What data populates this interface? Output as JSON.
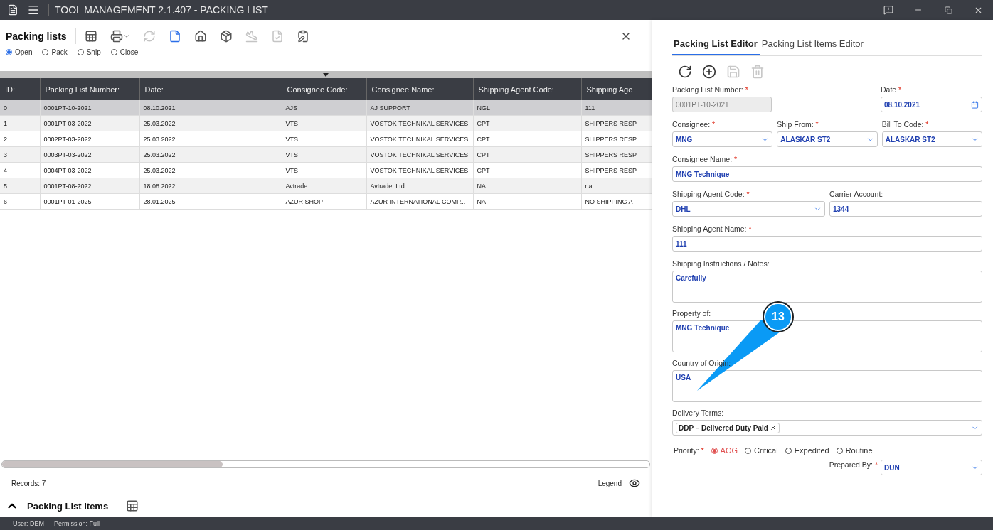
{
  "window": {
    "title": "TOOL MANAGEMENT 2.1.407 - PACKING LIST"
  },
  "list_panel": {
    "title": "Packing lists",
    "toolbar": [
      {
        "kind": "excel",
        "disabled": false
      },
      {
        "kind": "print",
        "disabled": false
      },
      {
        "kind": "refresh",
        "disabled": true
      },
      {
        "kind": "document",
        "disabled": false
      },
      {
        "kind": "home",
        "disabled": false
      },
      {
        "kind": "box",
        "disabled": false
      },
      {
        "kind": "plane",
        "disabled": true
      },
      {
        "kind": "doc-check",
        "disabled": true
      },
      {
        "kind": "clipboard",
        "disabled": false
      }
    ],
    "filters": [
      {
        "label": "Open",
        "selected": true
      },
      {
        "label": "Pack",
        "selected": false
      },
      {
        "label": "Ship",
        "selected": false
      },
      {
        "label": "Close",
        "selected": false
      }
    ],
    "table": {
      "columns": [
        "ID:",
        "Packing List Number:",
        "Date:",
        "Consignee Code:",
        "Consignee Name:",
        "Shipping Agent Code:",
        "Shipping Age"
      ],
      "rows": [
        {
          "selected": true,
          "cells": [
            "0",
            "0001PT-10-2021",
            "08.10.2021",
            "AJS",
            "AJ SUPPORT",
            "NGL",
            "111"
          ]
        },
        {
          "selected": false,
          "cells": [
            "1",
            "0001PT-03-2022",
            "25.03.2022",
            "VTS",
            "VOSTOK TECHNIKAL SERVICES",
            "CPT",
            "SHIPPERS RESP"
          ]
        },
        {
          "selected": false,
          "cells": [
            "2",
            "0002PT-03-2022",
            "25.03.2022",
            "VTS",
            "VOSTOK TECHNIKAL SERVICES",
            "CPT",
            "SHIPPERS RESP"
          ]
        },
        {
          "selected": false,
          "cells": [
            "3",
            "0003PT-03-2022",
            "25.03.2022",
            "VTS",
            "VOSTOK TECHNIKAL SERVICES",
            "CPT",
            "SHIPPERS RESP"
          ]
        },
        {
          "selected": false,
          "cells": [
            "4",
            "0004PT-03-2022",
            "25.03.2022",
            "VTS",
            "VOSTOK TECHNIKAL SERVICES",
            "CPT",
            "SHIPPERS RESP"
          ]
        },
        {
          "selected": false,
          "cells": [
            "5",
            "0001PT-08-2022",
            "18.08.2022",
            "Avtrade",
            "Avtrade, Ltd.",
            "NA",
            "na"
          ]
        },
        {
          "selected": false,
          "cells": [
            "6",
            "0001PT-01-2025",
            "28.01.2025",
            "AZUR SHOP",
            "AZUR INTERNATIONAL COMP...",
            "NA",
            "NO SHIPPING A"
          ]
        }
      ]
    },
    "records": "Records: 7",
    "legend": "Legend"
  },
  "items_bar": {
    "title": "Packing List Items"
  },
  "editor": {
    "tabs": [
      {
        "label": "Packing List Editor",
        "selected": true
      },
      {
        "label": "Packing List Items Editor",
        "selected": false
      }
    ],
    "toolbar": [
      {
        "kind": "undo",
        "disabled": false
      },
      {
        "kind": "add",
        "disabled": false
      },
      {
        "kind": "save",
        "disabled": true
      },
      {
        "kind": "delete",
        "disabled": true
      }
    ],
    "rows": [
      {
        "kind": "number-date",
        "fields": [
          {
            "kind": "input",
            "label": "Packing List Number:",
            "required_mark": "*",
            "value": "0001PT-10-2021",
            "disabled": true
          },
          {
            "kind": "date",
            "label": "Date",
            "required_mark": "*",
            "value": "08.10.2021",
            "disabled": false
          }
        ]
      },
      {
        "kind": "thirds",
        "fields": [
          {
            "kind": "select",
            "label": "Consignee:",
            "required_mark": "*",
            "value": "MNG",
            "disabled": false
          },
          {
            "kind": "select",
            "label": "Ship From:",
            "required_mark": "*",
            "value": "ALASKAR ST2",
            "disabled": false
          },
          {
            "kind": "select",
            "label": "Bill To Code:",
            "required_mark": "*",
            "value": "ALASKAR ST2",
            "disabled": false
          }
        ]
      },
      {
        "kind": "full",
        "fields": [
          {
            "kind": "input",
            "label": "Consignee Name:",
            "required_mark": "*",
            "value": "MNG Technique",
            "disabled": false
          }
        ]
      },
      {
        "kind": "halves",
        "fields": [
          {
            "kind": "select",
            "label": "Shipping Agent Code:",
            "required_mark": "*",
            "value": "DHL",
            "disabled": false
          },
          {
            "kind": "input",
            "label": "Carrier Account:",
            "value": "1344",
            "disabled": false
          }
        ]
      },
      {
        "kind": "full",
        "fields": [
          {
            "kind": "input",
            "label": "Shipping Agent Name:",
            "required_mark": "*",
            "value": "111",
            "disabled": false
          }
        ]
      },
      {
        "kind": "full",
        "fields": [
          {
            "kind": "textarea",
            "label": "Shipping Instructions / Notes:",
            "value": "Carefully",
            "disabled": false
          }
        ]
      },
      {
        "kind": "full",
        "fields": [
          {
            "kind": "textarea",
            "label": "Property of:",
            "value": "MNG Technique",
            "disabled": false
          }
        ]
      },
      {
        "kind": "full",
        "fields": [
          {
            "kind": "textarea",
            "label": "Country of Origin:",
            "value": "USA",
            "disabled": false
          }
        ]
      },
      {
        "kind": "full",
        "fields": [
          {
            "kind": "tags",
            "label": "Delivery Terms:",
            "value": "DDP – Delivered Duty Paid",
            "disabled": false
          }
        ]
      }
    ],
    "priority": {
      "label": "Priority:",
      "required_mark": "*",
      "options": [
        {
          "label": "AOG",
          "selected": true
        },
        {
          "label": "Critical",
          "selected": false
        },
        {
          "label": "Expedited",
          "selected": false
        },
        {
          "label": "Routine",
          "selected": false
        }
      ]
    },
    "prepared_by": {
      "label": "Prepared By:",
      "required_mark": "*",
      "value": "DUN"
    }
  },
  "callout": {
    "number": "13"
  },
  "status_bar": {
    "user": "User: DEM",
    "permission": "Permission: Full"
  }
}
